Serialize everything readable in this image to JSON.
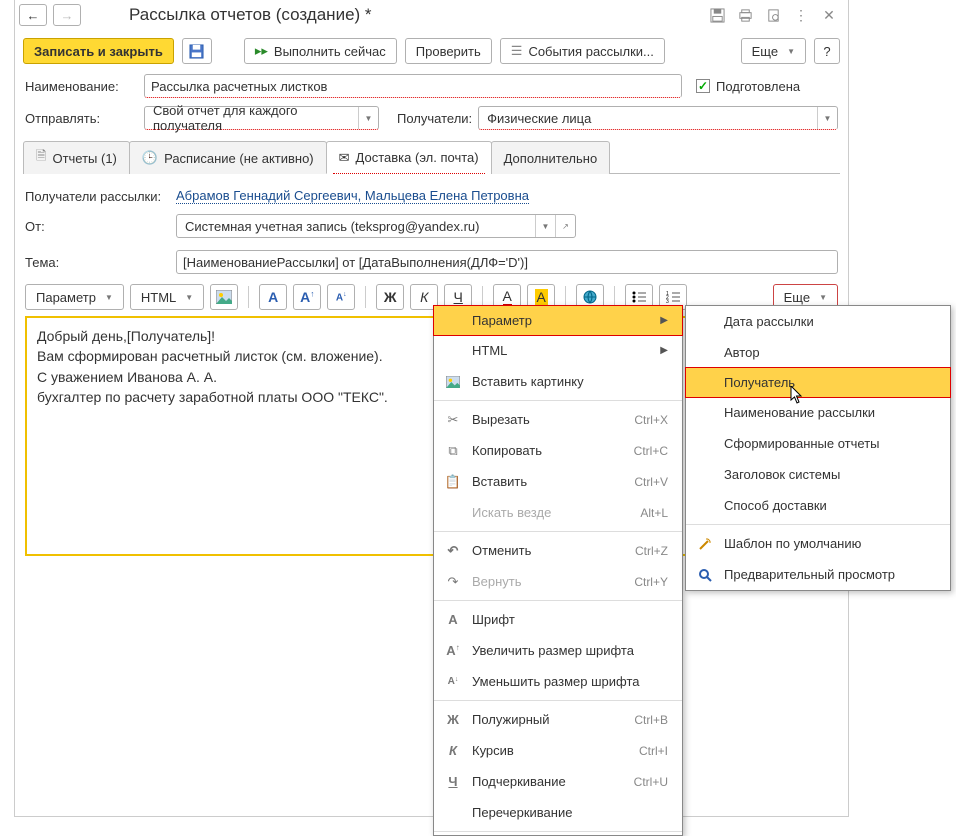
{
  "title": "Рассылка отчетов (создание) *",
  "toolbar": {
    "save_close": "Записать и закрыть",
    "execute_now": "Выполнить сейчас",
    "check": "Проверить",
    "events": "События рассылки...",
    "more": "Еще",
    "help": "?"
  },
  "form": {
    "name_label": "Наименование:",
    "name_value": "Рассылка расчетных листков",
    "prepared_label": "Подготовлена",
    "send_label": "Отправлять:",
    "send_value": "Свой отчет для каждого получателя",
    "recipients_label": "Получатели:",
    "recipients_value": "Физические лица"
  },
  "tabs": {
    "reports": "Отчеты (1)",
    "schedule": "Расписание (не активно)",
    "delivery": "Доставка (эл. почта)",
    "additional": "Дополнительно"
  },
  "delivery": {
    "recipients_label": "Получатели рассылки:",
    "recipients_value": "Абрамов Геннадий Сергеевич, Мальцева Елена Петровна",
    "from_label": "От:",
    "from_value": "Системная учетная запись (teksprog@yandex.ru)",
    "subject_label": "Тема:",
    "subject_value": "[НаименованиеРассылки] от [ДатаВыполнения(ДЛФ='D')]"
  },
  "editor": {
    "param_btn": "Параметр",
    "html_btn": "HTML",
    "more": "Еще",
    "body_line1": "Добрый день,[Получатель]!",
    "body_line2": "Вам сформирован расчетный листок (см. вложение).",
    "body_line3": "С уважением Иванова А. А.",
    "body_line4": "бухгалтер по расчету заработной платы ООО \"ТЕКС\"."
  },
  "ctx1": {
    "param": "Параметр",
    "html": "HTML",
    "insert_img": "Вставить картинку",
    "cut": "Вырезать",
    "cut_sc": "Ctrl+X",
    "copy": "Копировать",
    "copy_sc": "Ctrl+C",
    "paste": "Вставить",
    "paste_sc": "Ctrl+V",
    "find": "Искать везде",
    "find_sc": "Alt+L",
    "undo": "Отменить",
    "undo_sc": "Ctrl+Z",
    "redo": "Вернуть",
    "redo_sc": "Ctrl+Y",
    "font": "Шрифт",
    "inc_font": "Увеличить размер шрифта",
    "dec_font": "Уменьшить размер шрифта",
    "bold": "Полужирный",
    "bold_sc": "Ctrl+B",
    "italic": "Курсив",
    "italic_sc": "Ctrl+I",
    "underline": "Подчеркивание",
    "underline_sc": "Ctrl+U",
    "strike": "Перечеркивание"
  },
  "ctx2": {
    "date": "Дата рассылки",
    "author": "Автор",
    "recipient": "Получатель",
    "name": "Наименование рассылки",
    "reports": "Сформированные отчеты",
    "system_title": "Заголовок системы",
    "delivery_method": "Способ доставки",
    "default_template": "Шаблон по умолчанию",
    "preview": "Предварительный просмотр"
  }
}
